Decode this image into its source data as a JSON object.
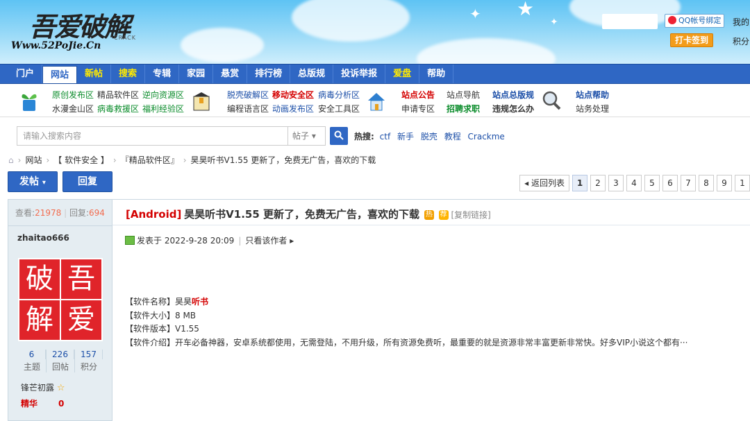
{
  "header": {
    "logo_cn": "吾爱破解",
    "logo_crack": "CRACK",
    "logo_url": "Www.52PoJie.Cn",
    "qq_bind": "QQ帐号绑定",
    "mine": "我的",
    "signin": "打卡签到",
    "points": "积分"
  },
  "nav": {
    "items": [
      {
        "label": "门户"
      },
      {
        "label": "网站"
      },
      {
        "label": "新帖"
      },
      {
        "label": "搜索"
      },
      {
        "label": "专辑"
      },
      {
        "label": "家园"
      },
      {
        "label": "悬赏"
      },
      {
        "label": "排行榜"
      },
      {
        "label": "总版规"
      },
      {
        "label": "投诉举报"
      },
      {
        "label": "爱盘"
      },
      {
        "label": "帮助"
      }
    ]
  },
  "subnav": {
    "col1": [
      "原创发布区",
      "水漫金山区"
    ],
    "col2": [
      "精品软件区",
      "病毒救援区"
    ],
    "col3": [
      "逆向资源区",
      "福利经验区"
    ],
    "col4": [
      "脱壳破解区",
      "编程语言区"
    ],
    "col5": [
      "移动安全区",
      "动画发布区"
    ],
    "col6": [
      "病毒分析区",
      "安全工具区"
    ],
    "col7": [
      "站点公告",
      "申请专区"
    ],
    "col8": [
      "站点导航",
      "招聘求职"
    ],
    "col9": [
      "站点总版规",
      "违规怎么办"
    ],
    "col10": [
      "站点帮助",
      "站务处理"
    ]
  },
  "search": {
    "placeholder": "请输入搜索内容",
    "type": "帖子",
    "hot_label": "热搜:",
    "hot": [
      "ctf",
      "新手",
      "脱壳",
      "教程",
      "Crackme"
    ]
  },
  "breadcrumb": [
    "网站",
    "【 软件安全 】",
    "『精品软件区』",
    "昊昊听书V1.55 更新了，免费无广告，喜欢的下载"
  ],
  "actions": {
    "post": "发帖",
    "reply": "回复",
    "back": "◂ 返回列表",
    "pages": [
      "1",
      "2",
      "3",
      "4",
      "5",
      "6",
      "7",
      "8",
      "9",
      "1"
    ]
  },
  "sidebar": {
    "views_label": "查看:",
    "views": "21978",
    "replies_label": "回复:",
    "replies": "694",
    "author": "zhaitao666",
    "avatar_chars": [
      "破",
      "吾",
      "解",
      "爱"
    ],
    "stats": [
      {
        "n": "6",
        "l": "主题"
      },
      {
        "n": "226",
        "l": "回帖"
      },
      {
        "n": "157",
        "l": "积分"
      }
    ],
    "rank": "锋芒初露",
    "jinghua_label": "精华",
    "jinghua": "0"
  },
  "post": {
    "category": "[Android]",
    "title": "昊昊听书V1.55 更新了，免费无广告，喜欢的下载",
    "copy_link": "[复制链接]",
    "posted": "发表于 2022-9-28 20:09",
    "only_author": "只看该作者 ▸",
    "lines": [
      {
        "k": "【软件名称】昊昊",
        "v": "听书"
      },
      {
        "k": "【软件大小】8 MB",
        "v": ""
      },
      {
        "k": "【软件版本】V1.55",
        "v": ""
      },
      {
        "k": "【软件介绍】开车必备神器，安卓系统都使用，无需登陆，不用升级，所有资源免费听，最重要的就是资源非常丰富更新非常快。好多VIP小说这个都有···",
        "v": ""
      }
    ]
  }
}
